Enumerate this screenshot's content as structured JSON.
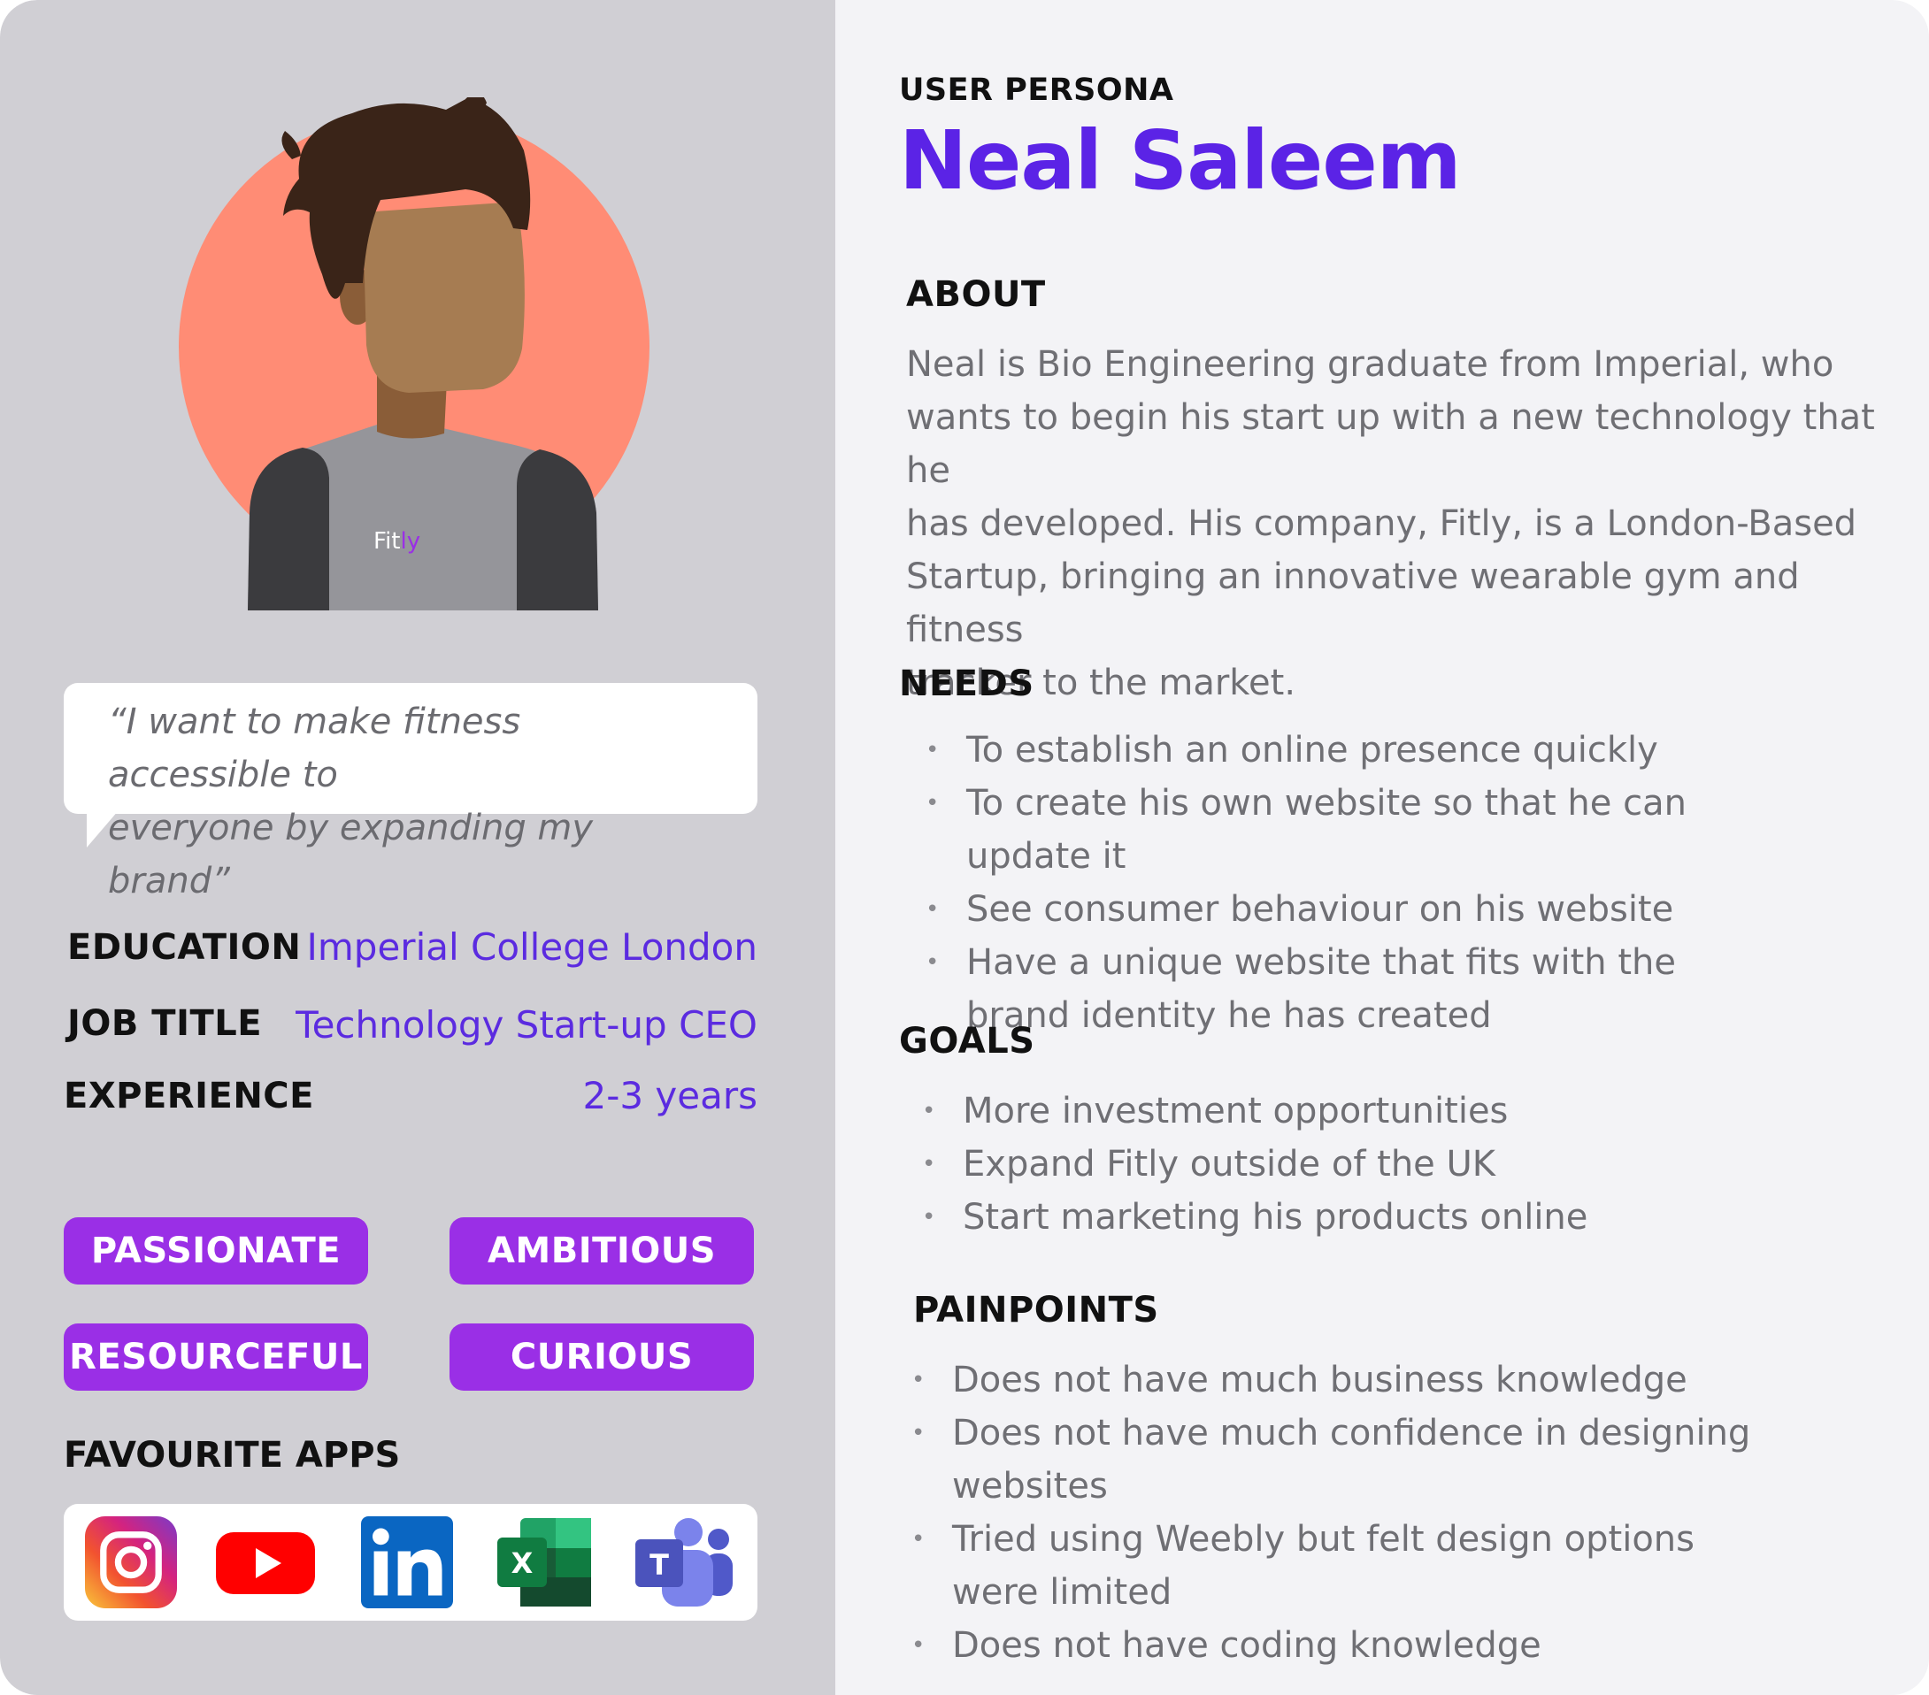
{
  "header": {
    "eyebrow": "USER PERSONA",
    "name": "Neal Saleem"
  },
  "avatar": {
    "shirt_brand_part1": "Fit",
    "shirt_brand_part2": "ly"
  },
  "quote": {
    "line1": "“I want to make fitness accessible to",
    "line2": "everyone by expanding my brand”"
  },
  "info": {
    "education_label": "EDUCATION",
    "education_value": "Imperial College London",
    "job_label": "JOB TITLE",
    "job_value": "Technology Start-up CEO",
    "experience_label": "EXPERIENCE",
    "experience_value": "2-3 years"
  },
  "traits": [
    "PASSIONATE",
    "AMBITIOUS",
    "RESOURCEFUL",
    "CURIOUS"
  ],
  "favourite_apps": {
    "title": "FAVOURITE APPS",
    "icons": [
      "instagram-icon",
      "youtube-icon",
      "linkedin-icon",
      "excel-icon",
      "teams-icon"
    ]
  },
  "about": {
    "title": "ABOUT",
    "lines": [
      "Neal is Bio Engineering graduate from Imperial, who",
      "wants to begin his start up with a new technology that he",
      "has developed. His company, Fitly, is a London-Based",
      "Startup, bringing an innovative wearable gym and fitness",
      "tracker to the market."
    ]
  },
  "needs": {
    "title": "NEEDS",
    "items": [
      "To establish an online presence quickly",
      "To create his own website so that he can update it",
      "See consumer behaviour on his website",
      "Have a unique website that fits with the brand identity he has created"
    ]
  },
  "goals": {
    "title": "GOALS",
    "items": [
      "More investment opportunities",
      "Expand Fitly outside of the UK",
      "Start marketing his products online"
    ]
  },
  "painpoints": {
    "title": "PAINPOINTS",
    "items": [
      "Does not have much business knowledge",
      "Does not have much confidence in designing websites",
      "Tried using Weebly but felt design options were limited",
      "Does not have coding knowledge"
    ]
  },
  "colors": {
    "accent_purple": "#5b23e6",
    "trait_purple": "#9a2fe6",
    "avatar_circle": "#ff8c75",
    "left_panel": "#d0cfd4",
    "right_panel": "#f3f3f6"
  }
}
